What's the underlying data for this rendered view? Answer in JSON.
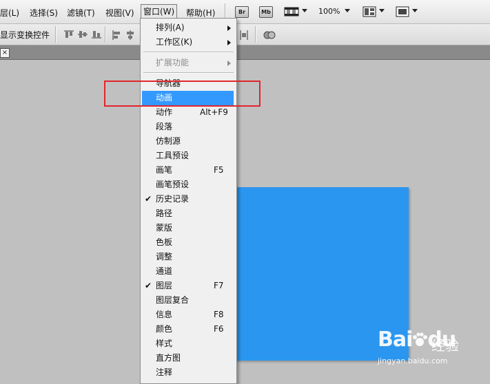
{
  "menubar": {
    "items": [
      "层(L)",
      "选择(S)",
      "滤镜(T)",
      "视图(V)",
      "窗口(W)",
      "帮助(H)"
    ],
    "bridge_label": "Br",
    "minibridge_label": "Mb",
    "zoom": "100%"
  },
  "options_bar": {
    "show_transform_controls": "显示变换控件"
  },
  "tab": {
    "close_glyph": "×"
  },
  "window_menu": {
    "items": [
      {
        "label": "排列(A)",
        "submenu": true
      },
      {
        "label": "工作区(K)",
        "submenu": true
      },
      {
        "label": "扩展功能",
        "submenu": true,
        "disabled": true
      },
      {
        "label": "导航器"
      },
      {
        "label": "动画",
        "highlighted": true
      },
      {
        "label": "动作",
        "shortcut": "Alt+F9"
      },
      {
        "label": "段落"
      },
      {
        "label": "仿制源"
      },
      {
        "label": "工具预设"
      },
      {
        "label": "画笔",
        "shortcut": "F5"
      },
      {
        "label": "画笔预设"
      },
      {
        "label": "历史记录",
        "checked": true
      },
      {
        "label": "路径"
      },
      {
        "label": "蒙版"
      },
      {
        "label": "色板"
      },
      {
        "label": "调整"
      },
      {
        "label": "通道"
      },
      {
        "label": "图层",
        "shortcut": "F7",
        "checked": true
      },
      {
        "label": "图层复合"
      },
      {
        "label": "信息",
        "shortcut": "F8"
      },
      {
        "label": "颜色",
        "shortcut": "F6"
      },
      {
        "label": "样式"
      },
      {
        "label": "直方图"
      },
      {
        "label": "注释"
      }
    ],
    "check_glyph": "✔"
  },
  "colors": {
    "highlight": "#3399ff",
    "document_fill": "#2b96ef",
    "callout": "#e3242b"
  },
  "watermark": {
    "brand": "Bai",
    "brand_suffix": "du",
    "word": "经验",
    "url": "jingyan.baidu.com"
  }
}
